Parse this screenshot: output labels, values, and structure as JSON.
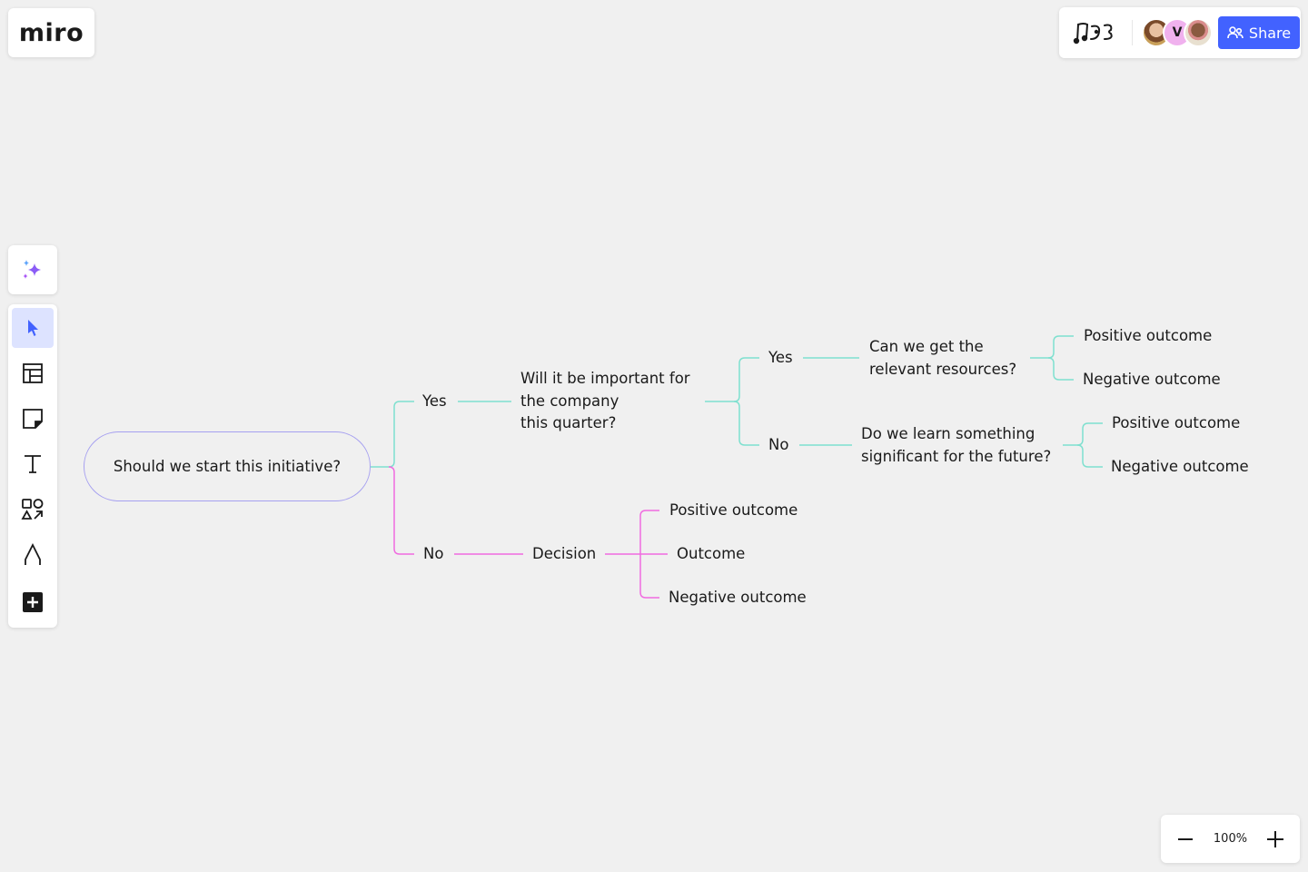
{
  "app": {
    "logo_text": "miro"
  },
  "header": {
    "board_logo_icon": "music-doodle-icon",
    "collaborators": [
      {
        "name": "collaborator-1",
        "type": "photo",
        "color": "#c9a05a"
      },
      {
        "name": "collaborator-v",
        "initial": "V",
        "color": "#f0b1ee"
      },
      {
        "name": "collaborator-3",
        "type": "photo",
        "color": "#d98c8c"
      }
    ],
    "share_label": "Share",
    "share_icon": "users-icon",
    "share_color": "#4262ff"
  },
  "toolbar": {
    "ai_icon": "sparkles-icon",
    "tools": [
      {
        "name": "select",
        "icon": "cursor-icon",
        "active": true
      },
      {
        "name": "templates",
        "icon": "layout-icon",
        "active": false
      },
      {
        "name": "sticky-note",
        "icon": "sticky-note-icon",
        "active": false
      },
      {
        "name": "text",
        "icon": "text-icon",
        "active": false
      },
      {
        "name": "shapes",
        "icon": "shapes-icon",
        "active": false
      },
      {
        "name": "pen",
        "icon": "pen-icon",
        "active": false
      },
      {
        "name": "more",
        "icon": "plus-square-icon",
        "active": false
      }
    ]
  },
  "zoom": {
    "level": "100%",
    "minus_icon": "minus-icon",
    "plus_icon": "plus-icon"
  },
  "mindmap": {
    "colors": {
      "root_border": "#a6a0f0",
      "yes_branch": "#7ee0cf",
      "no_branch": "#f06be0"
    },
    "root": "Should we start this initiative?",
    "yes": {
      "label": "Yes",
      "question": [
        "Will it be important for",
        "the company",
        "this quarter?"
      ],
      "yes": {
        "label": "Yes",
        "question": [
          "Can we get the",
          "relevant resources?"
        ],
        "outcomes": [
          "Positive outcome",
          "Negative outcome"
        ]
      },
      "no": {
        "label": "No",
        "question": [
          "Do we learn something",
          "significant for the future?"
        ],
        "outcomes": [
          "Positive outcome",
          "Negative outcome"
        ]
      }
    },
    "no": {
      "label": "No",
      "decision": "Decision",
      "outcomes": [
        "Positive outcome",
        "Outcome",
        "Negative outcome"
      ]
    }
  }
}
